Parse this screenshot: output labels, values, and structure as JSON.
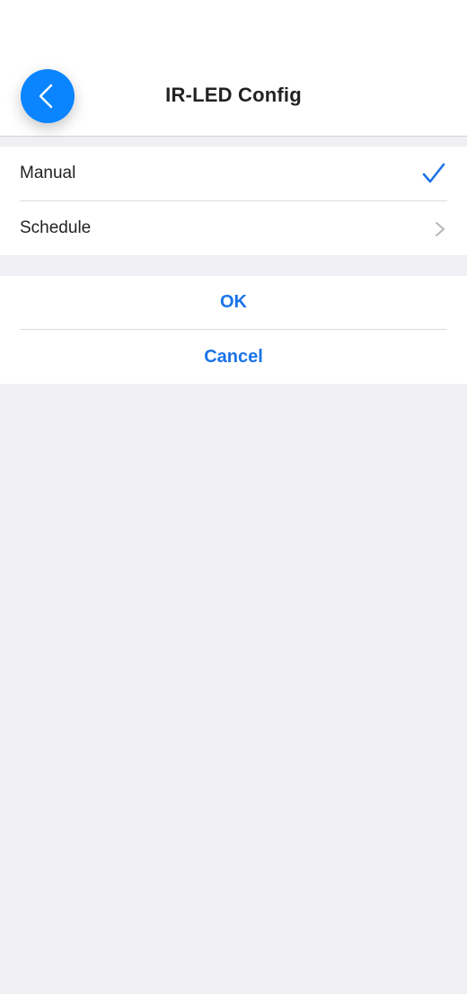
{
  "header": {
    "title": "IR-LED Config",
    "back_icon": "chevron-left-icon"
  },
  "modes": {
    "items": [
      {
        "label": "Manual",
        "selected": true,
        "indicator_icon": "checkmark-icon"
      },
      {
        "label": "Schedule",
        "selected": false,
        "indicator_icon": "chevron-right-icon"
      }
    ]
  },
  "actions": {
    "ok_label": "OK",
    "cancel_label": "Cancel"
  },
  "colors": {
    "accent": "#1a73e8",
    "back_button": "#0a84ff",
    "background": "#efeff4",
    "surface": "#ffffff"
  }
}
